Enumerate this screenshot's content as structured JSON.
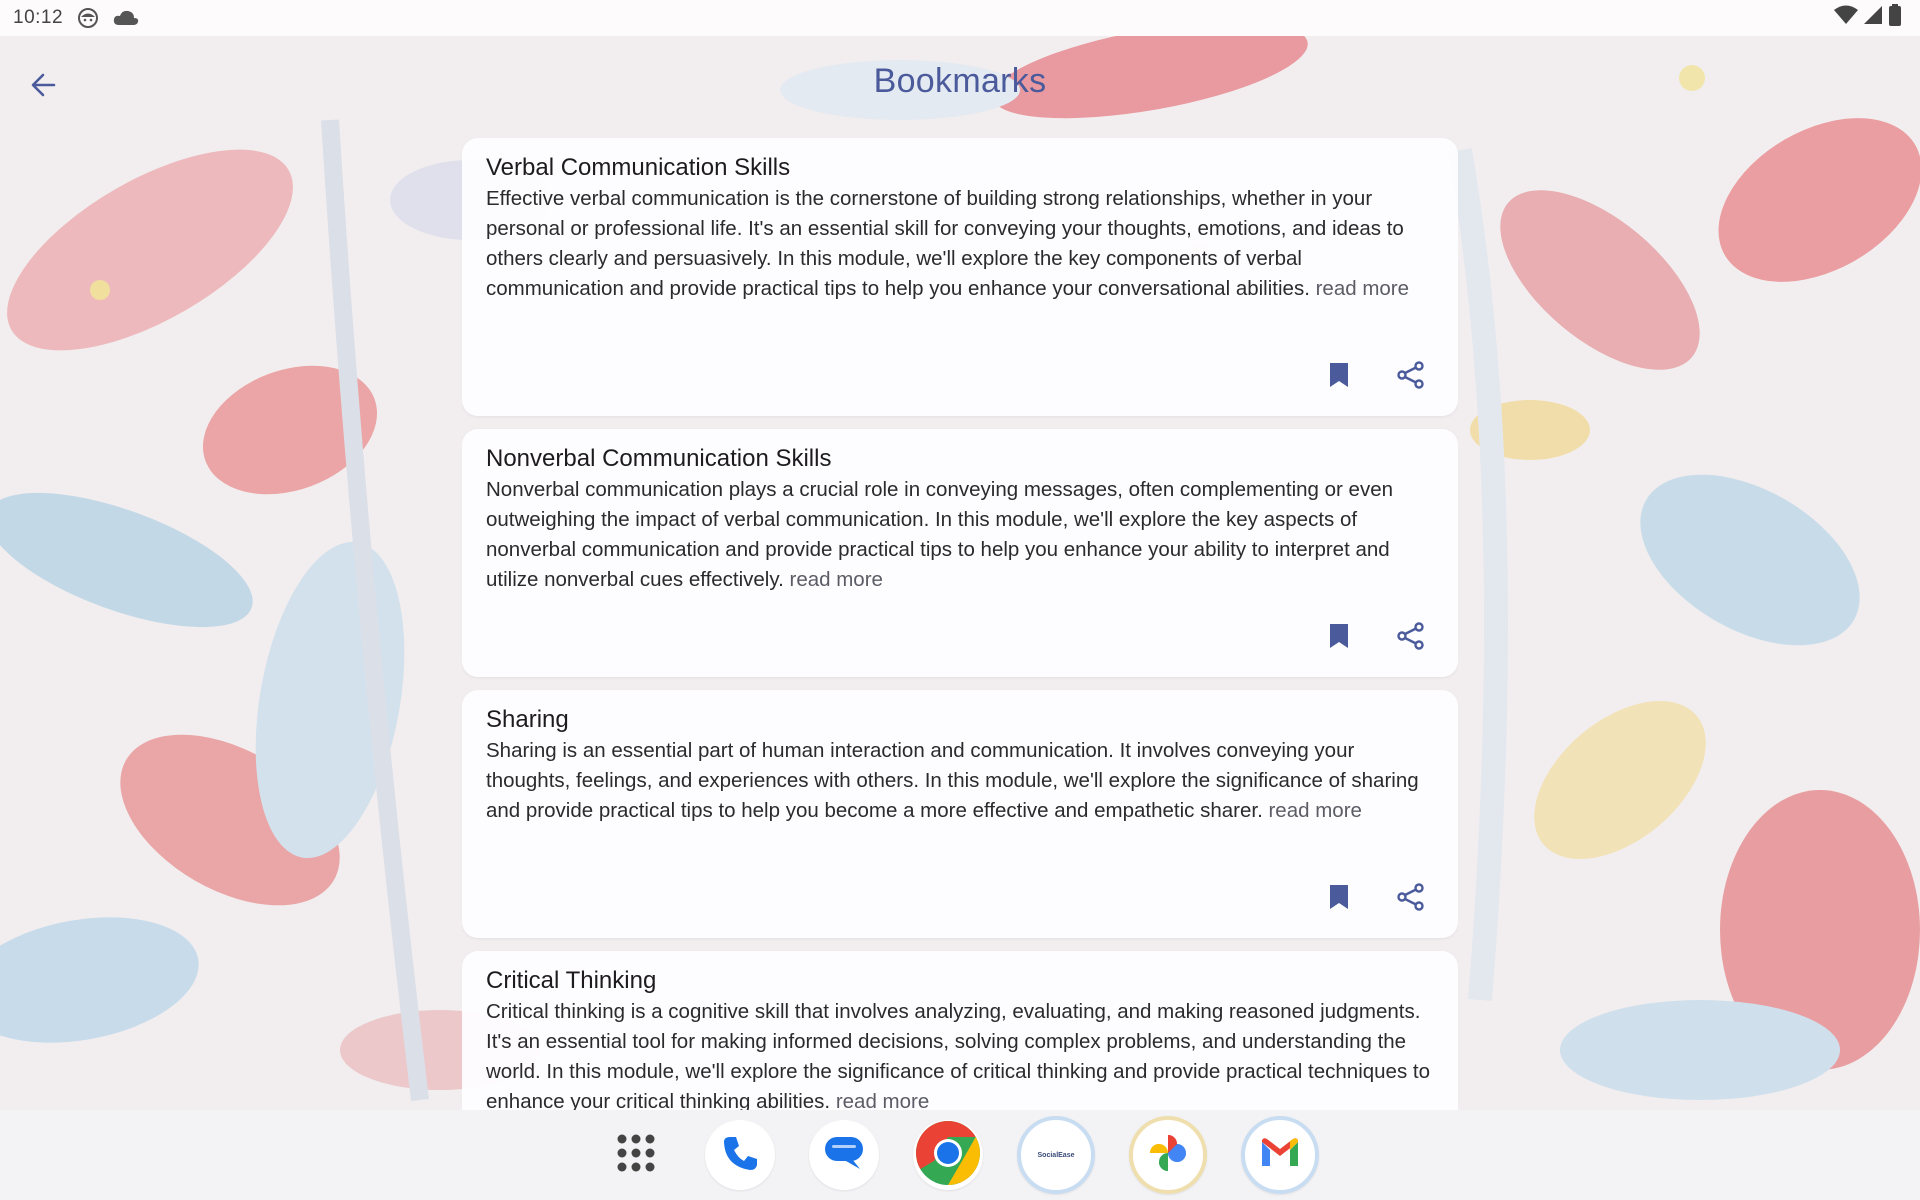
{
  "status_bar": {
    "time": "10:12",
    "left_icons": [
      "face-icon",
      "cloud-icon"
    ],
    "right_icons": [
      "wifi-icon",
      "signal-icon",
      "battery-icon"
    ]
  },
  "header": {
    "title": "Bookmarks",
    "back_icon": "arrow-back-icon"
  },
  "cards": [
    {
      "title": "Verbal Communication Skills",
      "body": "Effective verbal communication is the cornerstone of building strong relationships, whether in your personal or professional life. It's an essential skill for conveying your thoughts, emotions, and ideas to others clearly and persuasively. In this module, we'll explore the key components of verbal communication and provide practical tips to help you enhance your conversational abilities.",
      "read_more": "read more"
    },
    {
      "title": "Nonverbal Communication Skills",
      "body": "Nonverbal communication plays a crucial role in conveying messages, often complementing or even outweighing the impact of verbal communication. In this module, we'll explore the key aspects of nonverbal communication and provide practical tips to help you enhance your ability to interpret and utilize nonverbal cues effectively.",
      "read_more": "read more"
    },
    {
      "title": "Sharing",
      "body": "Sharing is an essential part of human interaction and communication. It involves conveying your thoughts, feelings, and experiences with others. In this module, we'll explore the significance of sharing and provide practical tips to help you become a more effective and empathetic sharer.",
      "read_more": "read more"
    },
    {
      "title": "Critical Thinking",
      "body": "Critical thinking is a cognitive skill that involves analyzing, evaluating, and making reasoned judgments. It's an essential tool for making informed decisions, solving complex problems, and understanding the world. In this module, we'll explore the significance of critical thinking and provide practical techniques to enhance your critical thinking abilities.",
      "read_more": "read more"
    }
  ],
  "card_actions": [
    "bookmark-icon",
    "share-icon"
  ],
  "taskbar": {
    "apps": [
      "app-drawer-icon",
      "phone-icon",
      "messages-icon",
      "chrome-icon",
      "socialease-icon",
      "photos-icon",
      "gmail-icon"
    ],
    "socialease_label": "SocialEase"
  },
  "colors": {
    "accent": "#4a5a9b",
    "icon": "#4a5a9b",
    "card_bg": "#fdfcfe",
    "status_bar_bg": "#fdfbfc",
    "taskbar_bg": "#f3f3f5"
  }
}
